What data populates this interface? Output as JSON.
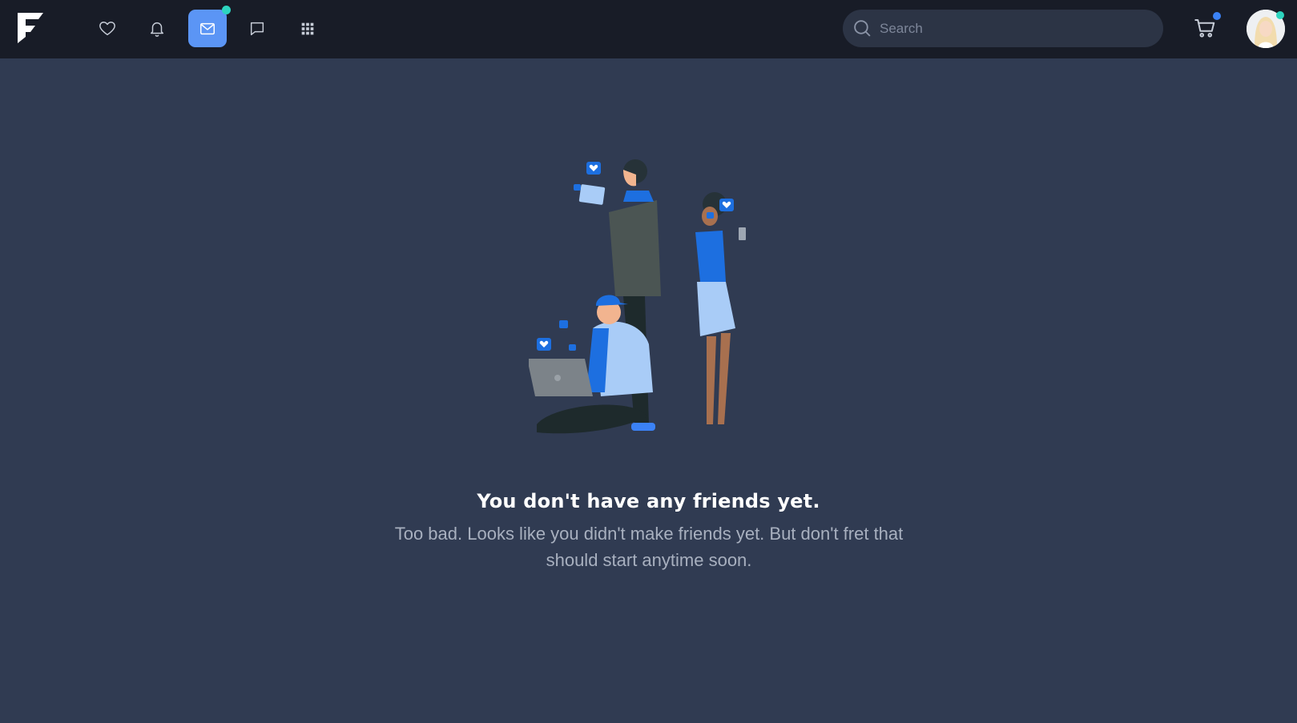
{
  "navbar": {
    "logo_icon": "f-logo-icon",
    "items": [
      {
        "name": "favorites",
        "icon": "heart-icon"
      },
      {
        "name": "notifications",
        "icon": "bell-icon"
      },
      {
        "name": "messages",
        "icon": "mail-icon",
        "active": true,
        "badge_color": "#2dd4bf"
      },
      {
        "name": "chat",
        "icon": "chat-bubble-icon"
      },
      {
        "name": "apps",
        "icon": "grid-icon"
      }
    ],
    "search": {
      "placeholder": "Search",
      "value": ""
    },
    "cart": {
      "icon": "cart-icon",
      "badge_color": "#3b82f6"
    },
    "avatar": {
      "status_color": "#2dd4bf"
    }
  },
  "empty_state": {
    "title": "You don't have any friends yet.",
    "message": "Too bad. Looks like you didn't make friends yet. But don't fret that should start anytime soon."
  },
  "colors": {
    "background": "#303b52",
    "navbar": "#181c27",
    "accent": "#5b95f5"
  }
}
